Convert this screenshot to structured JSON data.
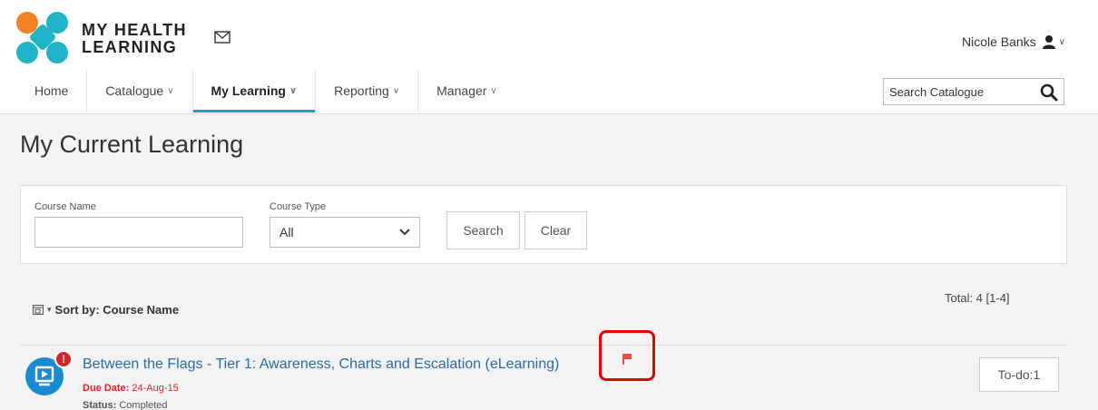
{
  "brand": {
    "line1": "MY HEALTH",
    "line2": "LEARNING"
  },
  "user": {
    "name": "Nicole Banks"
  },
  "nav": [
    {
      "label": "Home",
      "active": false,
      "dropdown": false
    },
    {
      "label": "Catalogue",
      "active": false,
      "dropdown": true
    },
    {
      "label": "My Learning",
      "active": true,
      "dropdown": true
    },
    {
      "label": "Reporting",
      "active": false,
      "dropdown": true
    },
    {
      "label": "Manager",
      "active": false,
      "dropdown": true
    }
  ],
  "search": {
    "placeholder": "Search Catalogue"
  },
  "page": {
    "title": "My Current Learning"
  },
  "filters": {
    "course_name_label": "Course Name",
    "course_name_value": "",
    "course_type_label": "Course Type",
    "course_type_value": "All",
    "search_button": "Search",
    "clear_button": "Clear"
  },
  "list": {
    "sort_label": "Sort by: Course Name",
    "total": "Total: 4 [1-4]"
  },
  "course": {
    "title": "Between the Flags - Tier 1: Awareness, Charts and Escalation (eLearning)",
    "alert": "!",
    "due_label": "Due Date:",
    "due_value": "24-Aug-15",
    "status_label": "Status:",
    "status_value": "Completed",
    "todo": "To-do:1"
  },
  "colors": {
    "accent": "#1da1c4",
    "link": "#2a6aa8",
    "alert": "#d9232a",
    "logo_orange": "#f58220",
    "logo_teal": "#1fb5c6"
  }
}
